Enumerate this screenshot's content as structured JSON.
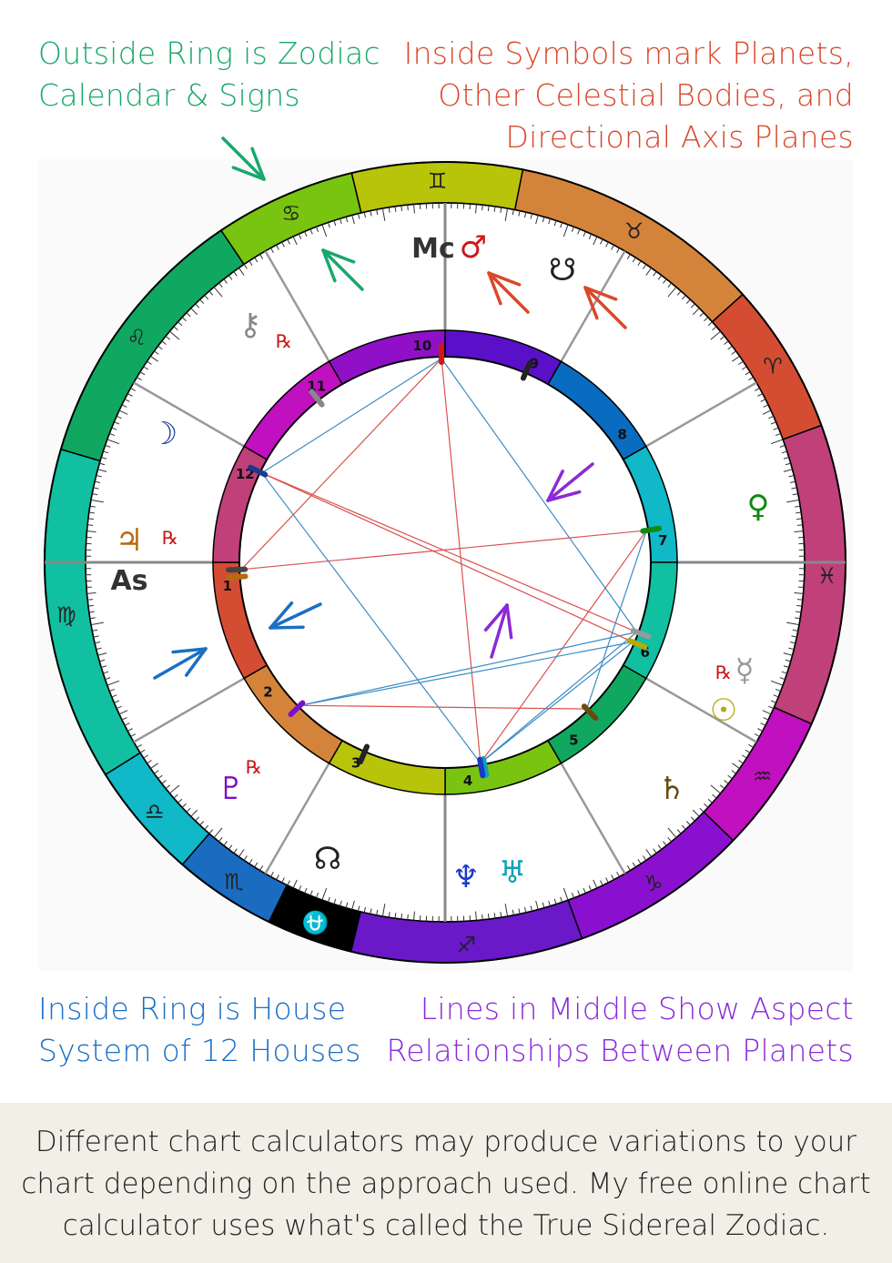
{
  "captions": {
    "top_left": [
      "Outside Ring is Zodiac",
      "Calendar & Signs"
    ],
    "top_right": [
      "Inside Symbols mark Planets,",
      "Other Celestial Bodies, and",
      "Directional Axis Planes"
    ],
    "bottom_left": [
      "Inside Ring is House",
      "System of 12 Houses"
    ],
    "bottom_right": [
      "Lines in Middle Show Aspect",
      "Relationships Between Planets"
    ]
  },
  "footer": [
    "Different chart calculators may produce variations to your",
    "chart depending on the approach used. My free online chart",
    "calculator uses what's called the True Sidereal Zodiac."
  ],
  "colors": {
    "top_left": "#17a86a",
    "top_right": "#d9482b",
    "bottom_left": "#1a6fc4",
    "bottom_right": "#8a2ad8",
    "aspect_red": "#d9534f",
    "aspect_blue": "#3a8cc4"
  },
  "zodiac": [
    {
      "sign": "Gemini",
      "glyph": "♊",
      "color": "#b8c40a"
    },
    {
      "sign": "Taurus",
      "glyph": "♉",
      "color": "#d4843a"
    },
    {
      "sign": "Aries",
      "glyph": "♈",
      "color": "#d44d33"
    },
    {
      "sign": "Pisces",
      "glyph": "♓",
      "color": "#c0407a"
    },
    {
      "sign": "Aquarius",
      "glyph": "♒",
      "color": "#c010c0"
    },
    {
      "sign": "Capricorn",
      "glyph": "♑",
      "color": "#8a10d0"
    },
    {
      "sign": "Sagittarius",
      "glyph": "♐",
      "color": "#6a18c8"
    },
    {
      "sign": "Ophiuchus",
      "glyph": "⛎",
      "color": "#000000"
    },
    {
      "sign": "Scorpio",
      "glyph": "♏",
      "color": "#1a6cc0"
    },
    {
      "sign": "Libra",
      "glyph": "♎",
      "color": "#10b8c8"
    },
    {
      "sign": "Virgo",
      "glyph": "♍",
      "color": "#10c0a0"
    },
    {
      "sign": "Leo",
      "glyph": "♌",
      "color": "#10a860"
    },
    {
      "sign": "Cancer",
      "glyph": "♋",
      "color": "#78c410"
    }
  ],
  "houses": [
    {
      "num": "10",
      "color": "#9010c8"
    },
    {
      "num": "9",
      "color": "#5a10c8"
    },
    {
      "num": "8",
      "color": "#0a6cc0"
    },
    {
      "num": "7",
      "color": "#10b8c8"
    },
    {
      "num": "6",
      "color": "#10c0a0"
    },
    {
      "num": "5",
      "color": "#10a860"
    },
    {
      "num": "4",
      "color": "#78c410"
    },
    {
      "num": "3",
      "color": "#b8c40a"
    },
    {
      "num": "2",
      "color": "#d4843a"
    },
    {
      "num": "1",
      "color": "#d44d33"
    },
    {
      "num": "12",
      "color": "#c0407a"
    },
    {
      "num": "11",
      "color": "#c010c0"
    }
  ],
  "bodies": [
    {
      "id": "mc",
      "glyph": "Mc",
      "color": "#333333",
      "rx": false
    },
    {
      "id": "mars",
      "glyph": "♂",
      "color": "#d01818",
      "rx": false
    },
    {
      "id": "southnode",
      "glyph": "☋",
      "color": "#222222",
      "rx": false
    },
    {
      "id": "chiron",
      "glyph": "⚷",
      "color": "#888888",
      "rx": true
    },
    {
      "id": "moon",
      "glyph": "☽",
      "color": "#1a3a8a",
      "rx": false
    },
    {
      "id": "jupiter",
      "glyph": "♃",
      "color": "#b86a10",
      "rx": true
    },
    {
      "id": "asc",
      "glyph": "As",
      "color": "#333333",
      "rx": false
    },
    {
      "id": "venus",
      "glyph": "♀",
      "color": "#108a10",
      "rx": false
    },
    {
      "id": "mercury",
      "glyph": "☿",
      "color": "#999999",
      "rx": true
    },
    {
      "id": "sun",
      "glyph": "☉",
      "color": "#b8a810",
      "rx": false
    },
    {
      "id": "saturn",
      "glyph": "♄",
      "color": "#6a4a10",
      "rx": false
    },
    {
      "id": "uranus",
      "glyph": "♅",
      "color": "#10a0b8",
      "rx": false
    },
    {
      "id": "neptune",
      "glyph": "♆",
      "color": "#1a3ac8",
      "rx": false
    },
    {
      "id": "pluto",
      "glyph": "♇",
      "color": "#7a10c8",
      "rx": true
    },
    {
      "id": "northnode",
      "glyph": "☊",
      "color": "#222222",
      "rx": false
    }
  ],
  "rx_label": "℞",
  "aspects": {
    "red": [
      [
        "mc",
        "asc"
      ],
      [
        "mc",
        "neptune"
      ],
      [
        "moon",
        "mercury"
      ],
      [
        "moon",
        "sun"
      ],
      [
        "asc",
        "venus"
      ],
      [
        "pluto",
        "saturn"
      ],
      [
        "neptune",
        "venus"
      ]
    ],
    "blue": [
      [
        "mc",
        "moon"
      ],
      [
        "mc",
        "mercury"
      ],
      [
        "moon",
        "neptune"
      ],
      [
        "pluto",
        "mercury"
      ],
      [
        "pluto",
        "sun"
      ],
      [
        "neptune",
        "mercury"
      ],
      [
        "neptune",
        "sun"
      ],
      [
        "venus",
        "saturn"
      ]
    ]
  }
}
